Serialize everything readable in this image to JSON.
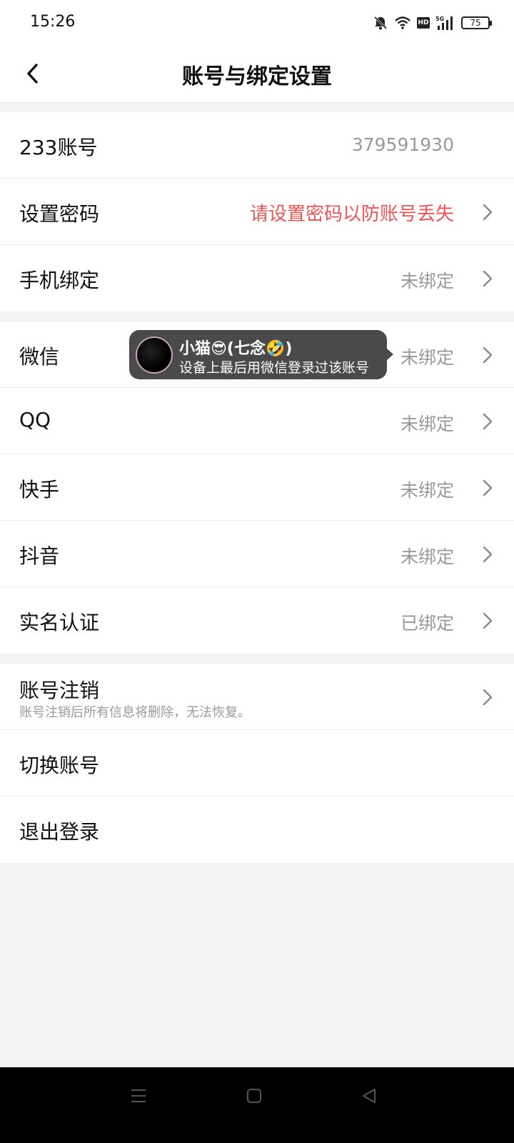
{
  "status_bar": {
    "time": "15:26",
    "battery": "75",
    "network": "5G",
    "hd": "HD"
  },
  "navbar": {
    "title": "账号与绑定设置"
  },
  "account_group": {
    "rows": [
      {
        "label": "233账号",
        "value": "379591930"
      },
      {
        "label": "设置密码",
        "value": "请设置密码以防账号丢失"
      },
      {
        "label": "手机绑定",
        "value": "未绑定"
      }
    ]
  },
  "binding_group": {
    "rows": [
      {
        "label": "微信",
        "value": "未绑定"
      },
      {
        "label": "QQ",
        "value": "未绑定"
      },
      {
        "label": "快手",
        "value": "未绑定"
      },
      {
        "label": "抖音",
        "value": "未绑定"
      },
      {
        "label": "实名认证",
        "value": "已绑定"
      }
    ]
  },
  "tooltip": {
    "name": "小猫😎(七念🤣)",
    "desc": "设备上最后用微信登录过该账号"
  },
  "action_group": {
    "cancel": {
      "label": "账号注销",
      "sub": "账号注销后所有信息将删除，无法恢复。"
    },
    "switch_label": "切换账号",
    "logout_label": "退出登录"
  },
  "colors": {
    "warn": "#f05454",
    "muted": "#999999",
    "background": "#f2f2f2"
  }
}
